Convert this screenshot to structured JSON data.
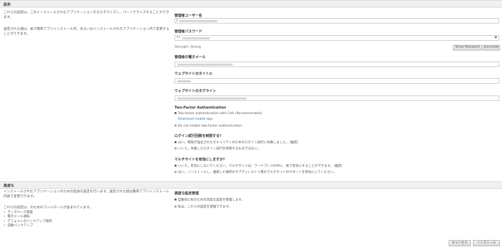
{
  "settings": {
    "title": "設定",
    "desc1": "これらの設定は、このインストールされたアプリケーションをカスタマイズし、パーソナライズすることができます。",
    "desc2": "設定された値は、後で簡単アプリインストール内、あるいはインストールされたアプリケーション内で変更することができます。",
    "admin_user_label": "管理者ユーザー名",
    "admin_user_value": "t",
    "admin_password_label": "管理者パスワード",
    "admin_password_value": "••",
    "strength_text": "Strength: Strong",
    "show_password_label": "Show Password",
    "generate_label": "Generate",
    "admin_email_label": "管理者の電子メール",
    "site_title_label": "ウェブサイトのタイトル",
    "site_tagline_label": "ウェブサイトのタグライン",
    "tfa_title": "Two-Factor Authentication",
    "tfa_option1": "Two-factor authentication with Clef. (Recommended)",
    "tfa_download_link": "Download mobile app",
    "tfa_option2": "Do not enable two-factor authentication.",
    "login_limit_title": "ログイン試行回数を制限する？",
    "login_limit_opt1": "はい。制限が強化されたセキュリティのためのログイン試行に失敗しました。（推奨）",
    "login_limit_opt2": "いいえ。失敗したログイン試行を制限するものではない。",
    "multisite_title": "マルチサイトを有効にしますか？",
    "multisite_opt1": "いいえ。有効にしないでください。マルチサイトは、ワードプレスの中に、後で有効にすることができます。（推奨）",
    "multisite_opt2": "はい。インストールし、選択した場所のサブディレクトリ用のマルチサイトのサポートを有効にしてください。"
  },
  "advanced": {
    "title": "高度な",
    "desc1": "インストールされたアプリケーションのための追加の設定を行います。設定された値は簡単アプリインストール内後で変更できます。",
    "desc2": "これらの設定は、のためのコントロールが含まれています。",
    "features": [
      "データベース管理",
      "電子メール通知",
      "デフォルトのバックアップ場所",
      "自動バックアップ"
    ],
    "options_title": "高度な設定管理",
    "opt1": "自動的に私のための高度な設定を管理します。",
    "opt2": "私は、これらの設定を管理できます。"
  },
  "footer": {
    "cancel_label": "キャンセル",
    "install_label": "インストール"
  },
  "colors": {
    "accent": "#2d6bb5",
    "header_bg": "#f0f0f0"
  }
}
